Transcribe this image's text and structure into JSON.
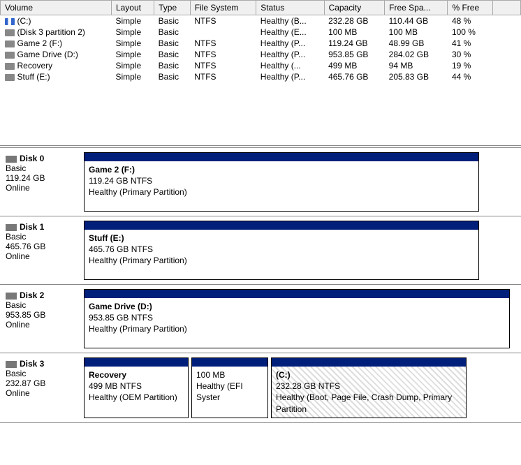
{
  "columns": [
    "Volume",
    "Layout",
    "Type",
    "File System",
    "Status",
    "Capacity",
    "Free Spa...",
    "% Free"
  ],
  "volumes": [
    {
      "icon": "stripe",
      "name": "(C:)",
      "layout": "Simple",
      "type": "Basic",
      "fs": "NTFS",
      "status": "Healthy (B...",
      "capacity": "232.28 GB",
      "free": "110.44 GB",
      "pct": "48 %"
    },
    {
      "icon": "disk",
      "name": "(Disk 3 partition 2)",
      "layout": "Simple",
      "type": "Basic",
      "fs": "",
      "status": "Healthy (E...",
      "capacity": "100 MB",
      "free": "100 MB",
      "pct": "100 %"
    },
    {
      "icon": "disk",
      "name": "Game 2 (F:)",
      "layout": "Simple",
      "type": "Basic",
      "fs": "NTFS",
      "status": "Healthy (P...",
      "capacity": "119.24 GB",
      "free": "48.99 GB",
      "pct": "41 %"
    },
    {
      "icon": "disk",
      "name": "Game Drive (D:)",
      "layout": "Simple",
      "type": "Basic",
      "fs": "NTFS",
      "status": "Healthy (P...",
      "capacity": "953.85 GB",
      "free": "284.02 GB",
      "pct": "30 %"
    },
    {
      "icon": "disk",
      "name": "Recovery",
      "layout": "Simple",
      "type": "Basic",
      "fs": "NTFS",
      "status": "Healthy (...",
      "capacity": "499 MB",
      "free": "94 MB",
      "pct": "19 %"
    },
    {
      "icon": "disk",
      "name": "Stuff (E:)",
      "layout": "Simple",
      "type": "Basic",
      "fs": "NTFS",
      "status": "Healthy (P...",
      "capacity": "465.76 GB",
      "free": "205.83 GB",
      "pct": "44 %"
    }
  ],
  "disks": [
    {
      "name": "Disk 0",
      "type": "Basic",
      "size": "119.24 GB",
      "state": "Online",
      "parts": [
        {
          "title": "Game 2  (F:)",
          "line2": "119.24 GB NTFS",
          "line3": "Healthy (Primary Partition)",
          "flex": "566",
          "hatched": false
        }
      ]
    },
    {
      "name": "Disk 1",
      "type": "Basic",
      "size": "465.76 GB",
      "state": "Online",
      "parts": [
        {
          "title": "Stuff  (E:)",
          "line2": "465.76 GB NTFS",
          "line3": "Healthy (Primary Partition)",
          "flex": "566",
          "hatched": false
        }
      ]
    },
    {
      "name": "Disk 2",
      "type": "Basic",
      "size": "953.85 GB",
      "state": "Online",
      "parts": [
        {
          "title": "Game Drive  (D:)",
          "line2": "953.85 GB NTFS",
          "line3": "Healthy (Primary Partition)",
          "flex": "610",
          "hatched": false
        }
      ]
    },
    {
      "name": "Disk 3",
      "type": "Basic",
      "size": "232.87 GB",
      "state": "Online",
      "parts": [
        {
          "title": "Recovery",
          "line2": "499 MB NTFS",
          "line3": "Healthy (OEM Partition)",
          "flex": "150",
          "hatched": false
        },
        {
          "title": "",
          "line2": "100 MB",
          "line3": "Healthy (EFI Syster",
          "flex": "110",
          "hatched": false
        },
        {
          "title": "(C:)",
          "line2": "232.28 GB NTFS",
          "line3": "Healthy (Boot, Page File, Crash Dump, Primary Partition",
          "flex": "280",
          "hatched": true
        }
      ]
    }
  ]
}
